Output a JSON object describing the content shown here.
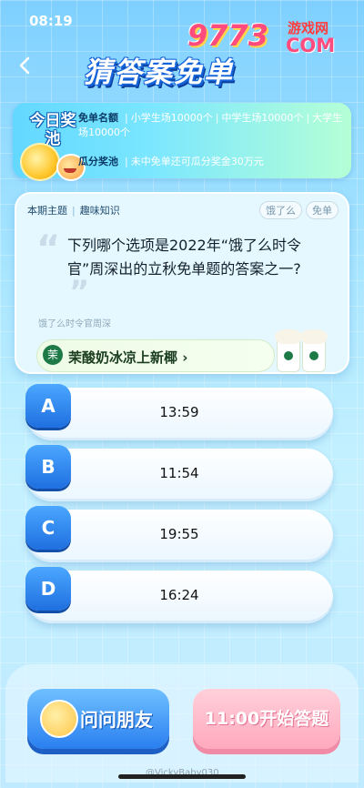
{
  "status_bar": {
    "time": "08:19"
  },
  "header": {
    "title": "猜答案免单",
    "brand_number": "9773",
    "brand_site": "游戏网",
    "brand_domain": "COM"
  },
  "prize_pool": {
    "label": "今日奖池",
    "free_order_tag": "免单名额",
    "free_order_items": [
      "小学生场10000个",
      "中学生场10000个",
      "大学生场10000个"
    ],
    "split_tag": "瓜分奖池",
    "split_text": "未中免单还可瓜分奖金30万元"
  },
  "question": {
    "topic_label": "本期主题",
    "topic_value": "趣味知识",
    "sponsor": "饿了么",
    "free_badge": "免单",
    "text": "下列哪个选项是2022年“饿了么时令官”周深出的立秋免单题的答案之一?",
    "hint": "饿了么时令官周深",
    "ad_text": "茉酸奶冰凉上新椰 ›",
    "ad_logo": "茉"
  },
  "options": [
    {
      "letter": "A",
      "value": "13:59"
    },
    {
      "letter": "B",
      "value": "11:54"
    },
    {
      "letter": "C",
      "value": "19:55"
    },
    {
      "letter": "D",
      "value": "16:24"
    }
  ],
  "footer": {
    "ask_friend": "问问朋友",
    "start_answer": "11:00开始答题",
    "watermark": "@VickyBaby030"
  }
}
